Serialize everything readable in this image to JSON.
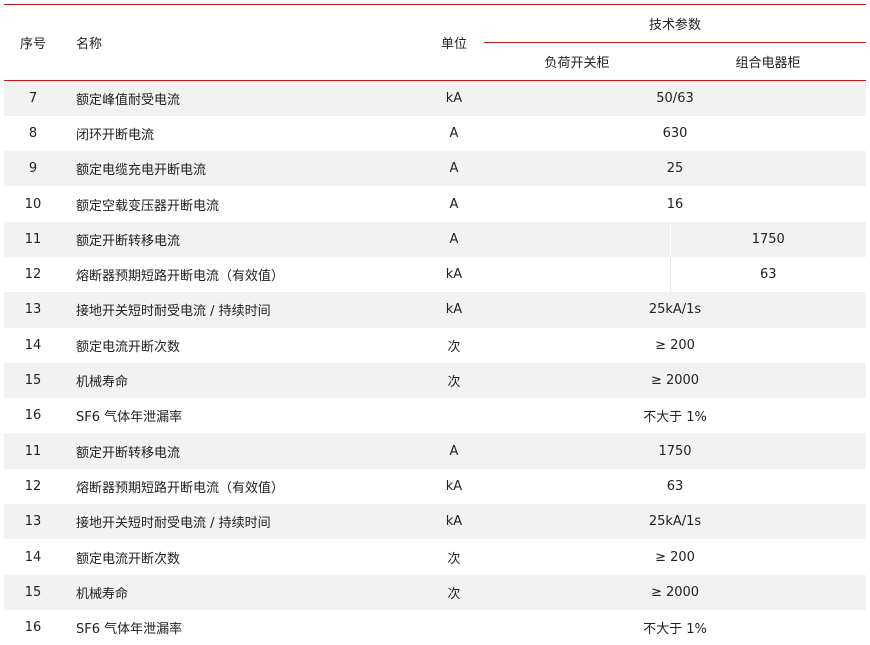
{
  "header": {
    "col_num": "序号",
    "col_name": "名称",
    "col_unit": "单位",
    "col_tech": "技术参数",
    "col_sub1": "负荷开关柜",
    "col_sub2": "组合电器柜"
  },
  "rows": [
    {
      "num": "7",
      "name": "额定峰值耐受电流",
      "unit": "kA",
      "span": true,
      "v": "50/63"
    },
    {
      "num": "8",
      "name": "闭环开断电流",
      "unit": "A",
      "span": true,
      "v": "630"
    },
    {
      "num": "9",
      "name": "额定电缆充电开断电流",
      "unit": "A",
      "span": true,
      "v": "25"
    },
    {
      "num": "10",
      "name": "额定空载变压器开断电流",
      "unit": "A",
      "span": true,
      "v": "16"
    },
    {
      "num": "11",
      "name": "额定开断转移电流",
      "unit": "A",
      "span": false,
      "v1": "",
      "v2": "1750"
    },
    {
      "num": "12",
      "name": "熔断器预期短路开断电流（有效值）",
      "unit": "kA",
      "span": false,
      "v1": "",
      "v2": "63"
    },
    {
      "num": "13",
      "name": "接地开关短时耐受电流 / 持续时间",
      "unit": "kA",
      "span": true,
      "v": "25kA/1s"
    },
    {
      "num": "14",
      "name": "额定电流开断次数",
      "unit": "次",
      "span": true,
      "v": "≥ 200"
    },
    {
      "num": "15",
      "name": "机械寿命",
      "unit": "次",
      "span": true,
      "v": "≥ 2000"
    },
    {
      "num": "16",
      "name": "SF6 气体年泄漏率",
      "unit": "",
      "span": true,
      "v": "不大于 1%"
    },
    {
      "num": "11",
      "name": "额定开断转移电流",
      "unit": "A",
      "span": true,
      "v": "1750"
    },
    {
      "num": "12",
      "name": "熔断器预期短路开断电流（有效值）",
      "unit": "kA",
      "span": true,
      "v": "63"
    },
    {
      "num": "13",
      "name": "接地开关短时耐受电流 / 持续时间",
      "unit": "kA",
      "span": true,
      "v": "25kA/1s"
    },
    {
      "num": "14",
      "name": "额定电流开断次数",
      "unit": "次",
      "span": true,
      "v": "≥ 200"
    },
    {
      "num": "15",
      "name": "机械寿命",
      "unit": "次",
      "span": true,
      "v": "≥ 2000"
    },
    {
      "num": "16",
      "name": "SF6 气体年泄漏率",
      "unit": "",
      "span": true,
      "v": "不大于 1%"
    }
  ],
  "accent_color": "#c8161d"
}
